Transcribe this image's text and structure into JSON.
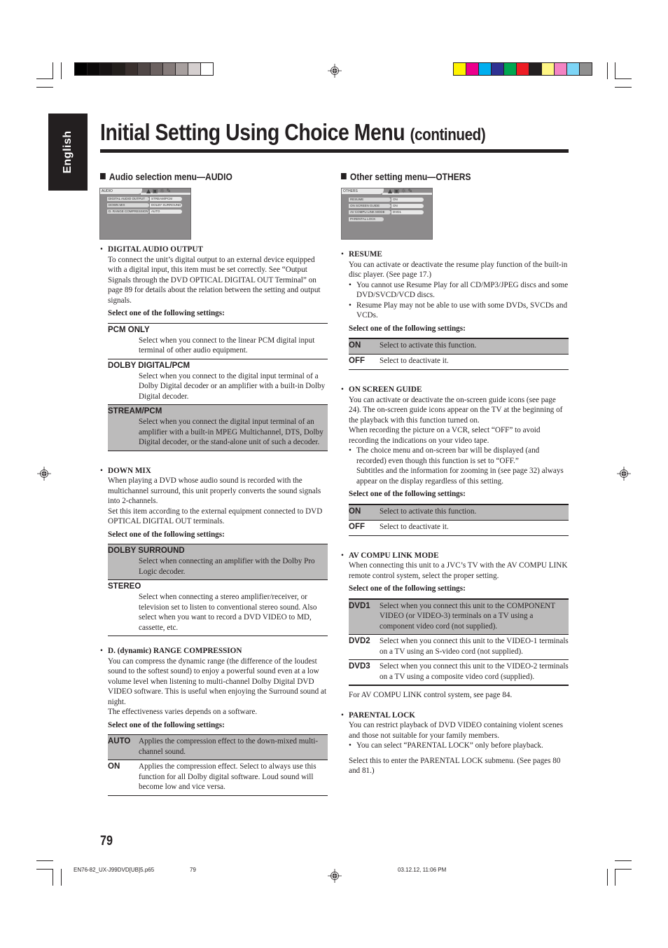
{
  "side_tab": "English",
  "title": {
    "main": "Initial Setting Using Choice Menu",
    "suffix": "(continued)"
  },
  "colors": {
    "gray_bar": [
      "#000000",
      "#0b0909",
      "#171313",
      "#231f1c",
      "#3a302e",
      "#504746",
      "#6b6160",
      "#857b7a",
      "#a8a09f",
      "#d5cfcf",
      "#ffffff"
    ],
    "color_bar": [
      "#fff200",
      "#ec008c",
      "#00aeef",
      "#2e3192",
      "#00a651",
      "#ed1c24",
      "#231f20",
      "#fff685",
      "#f384c3",
      "#7dd5f6",
      "#8f8f8f"
    ],
    "highlight": "#bcbbbb"
  },
  "audio": {
    "heading": "Audio selection menu—AUDIO",
    "screen": {
      "tab": "AUDIO",
      "rows": [
        {
          "label": "DIGITAL AUDIO OUTPUT",
          "value": "STREAM/PCM"
        },
        {
          "label": "DOWN MIX",
          "value": "DOLBY SURROUND"
        },
        {
          "label": "D. RANGE COMPRESSION",
          "value": "AUTO"
        }
      ]
    },
    "items": [
      {
        "title": "DIGITAL AUDIO OUTPUT",
        "body": "To connect the unit’s digital output to an external device equipped with a digital input, this item must be set correctly. See “Output Signals through the DVD OPTICAL DIGITAL OUT Terminal” on page 89 for details about the relation between the setting and output signals.",
        "select": "Select one of the following settings:",
        "options": [
          {
            "key": "PCM ONLY",
            "desc": "Select when you connect to the linear PCM digital input terminal of other audio equipment."
          },
          {
            "key": "DOLBY DIGITAL/PCM",
            "desc": "Select when you connect to the digital input terminal of a Dolby Digital decoder or an amplifier with a built-in Dolby Digital decoder."
          },
          {
            "key": "STREAM/PCM",
            "desc": "Select when you connect the digital input terminal of an amplifier with a built-in MPEG Multichannel, DTS, Dolby Digital decoder, or the stand-alone unit of such a decoder."
          }
        ]
      },
      {
        "title": "DOWN MIX",
        "body": "When playing a DVD whose audio sound is recorded with the multichannel surround, this unit properly converts the sound signals into 2-channels.",
        "body2": "Set this item according to the external equipment connected to DVD OPTICAL DIGITAL OUT terminals.",
        "select": "Select one of the following settings:",
        "options": [
          {
            "key": "DOLBY SURROUND",
            "desc": "Select when connecting an amplifier with the Dolby Pro Logic decoder."
          },
          {
            "key": "STEREO",
            "desc": "Select when connecting a stereo amplifier/receiver, or television set to listen to conventional stereo sound. Also select when you want to record a DVD VIDEO to MD, cassette, etc."
          }
        ]
      },
      {
        "title": "D. (dynamic) RANGE COMPRESSION",
        "body": "You can compress the dynamic range (the difference of the loudest sound to the softest sound) to enjoy a powerful sound even at a low volume level when listening to multi-channel Dolby Digital DVD VIDEO software. This is useful when enjoying the Surround sound at night.",
        "body2": "The effectiveness varies depends on a software.",
        "select": "Select one of the following settings:",
        "options": [
          {
            "key": "AUTO",
            "desc": "Applies the compression effect to the down-mixed multi-channel sound."
          },
          {
            "key": "ON",
            "desc": "Applies the compression effect. Select to always use this function for all Dolby digital software. Loud sound will become low and vice versa."
          }
        ]
      }
    ]
  },
  "others": {
    "heading": "Other setting menu—OTHERS",
    "screen": {
      "tab": "OTHERS",
      "rows": [
        {
          "label": "RESUME",
          "value": "ON"
        },
        {
          "label": "ON SCREEN GUIDE",
          "value": "ON"
        },
        {
          "label": "AV COMPU LINK MODE",
          "value": "DVD1"
        },
        {
          "label": "PARENTAL LOCK",
          "value": ""
        }
      ]
    },
    "resume": {
      "title": "RESUME",
      "body": "You can activate or deactivate the resume play function of the built-in disc player. (See page 17.)",
      "notes": [
        "You cannot use Resume Play for all CD/MP3/JPEG discs and some DVD/SVCD/VCD discs.",
        "Resume Play may not be able to use with some DVDs, SVCDs and VCDs."
      ],
      "select": "Select one of the following settings:",
      "options": [
        {
          "key": "ON",
          "desc": "Select to activate this function."
        },
        {
          "key": "OFF",
          "desc": "Select to deactivate it."
        }
      ]
    },
    "osg": {
      "title": "ON SCREEN GUIDE",
      "body": "You can activate or deactivate the on-screen guide icons (see page 24). The on-screen guide icons appear on the TV at the beginning of the playback with this function turned on.",
      "body2": "When recording the picture on a VCR, select “OFF” to avoid recording the indications on your video tape.",
      "note": "The choice menu and on-screen bar will be displayed (and recorded) even though this function is set to “OFF.”",
      "note2": "Subtitles and the information for zooming in (see page 32) always appear on the display regardless of this setting.",
      "select": "Select one of the following settings:",
      "options": [
        {
          "key": "ON",
          "desc": "Select to activate this function."
        },
        {
          "key": "OFF",
          "desc": "Select to deactivate it."
        }
      ]
    },
    "avcompu": {
      "title": "AV COMPU LINK MODE",
      "body": "When connecting this unit to a JVC’s TV with the AV COMPU LINK remote control system, select the proper setting.",
      "select": "Select one of the following settings:",
      "options": [
        {
          "key": "DVD1",
          "desc": "Select when you connect this unit to the COMPONENT VIDEO (or VIDEO-3) terminals on a TV using a component video cord (not supplied)."
        },
        {
          "key": "DVD2",
          "desc": "Select when you connect this unit to the VIDEO-1 terminals on a TV using an S-video cord (not supplied)."
        },
        {
          "key": "DVD3",
          "desc": "Select when you connect this unit to the VIDEO-2 terminals on a TV using a composite video cord (supplied)."
        }
      ],
      "footnote": "For AV COMPU LINK control system, see page 84."
    },
    "parental": {
      "title": "PARENTAL LOCK",
      "body": "You can restrict playback of DVD VIDEO containing violent scenes and those not suitable for your family members.",
      "note": "You can select “PARENTAL LOCK” only before playback.",
      "body2": "Select this to enter the PARENTAL LOCK submenu. (See pages 80 and 81.)"
    }
  },
  "page_number": "79",
  "footer": {
    "file": "EN76-82_UX-J99DVD[UB]5.p65",
    "page": "79",
    "timestamp": "03.12.12, 11:06 PM"
  },
  "bullet": "•"
}
